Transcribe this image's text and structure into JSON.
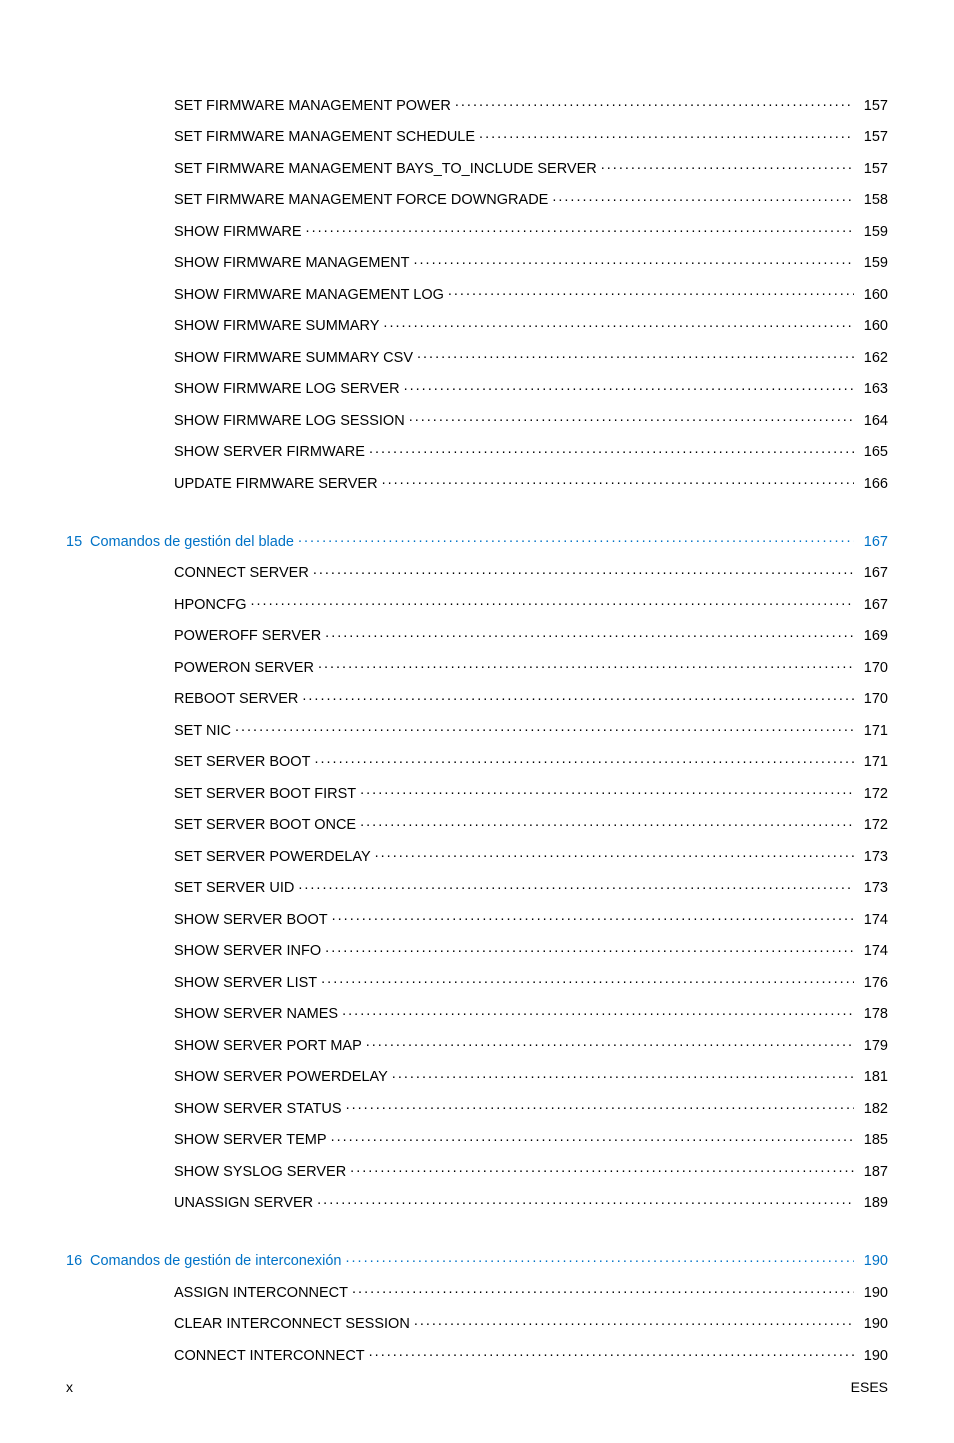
{
  "footer": {
    "left": "x",
    "right": "ESES"
  },
  "section0": {
    "items": [
      {
        "label": "SET FIRMWARE MANAGEMENT POWER",
        "page": "157"
      },
      {
        "label": "SET FIRMWARE MANAGEMENT SCHEDULE",
        "page": "157"
      },
      {
        "label": "SET FIRMWARE MANAGEMENT BAYS_TO_INCLUDE SERVER",
        "page": "157"
      },
      {
        "label": "SET FIRMWARE MANAGEMENT FORCE DOWNGRADE",
        "page": "158"
      },
      {
        "label": "SHOW FIRMWARE",
        "page": "159"
      },
      {
        "label": "SHOW FIRMWARE MANAGEMENT",
        "page": "159"
      },
      {
        "label": "SHOW FIRMWARE MANAGEMENT LOG",
        "page": "160"
      },
      {
        "label": "SHOW FIRMWARE SUMMARY",
        "page": "160"
      },
      {
        "label": "SHOW FIRMWARE SUMMARY CSV",
        "page": "162"
      },
      {
        "label": "SHOW FIRMWARE LOG SERVER",
        "page": "163"
      },
      {
        "label": "SHOW FIRMWARE LOG SESSION",
        "page": "164"
      },
      {
        "label": "SHOW SERVER FIRMWARE",
        "page": "165"
      },
      {
        "label": "UPDATE FIRMWARE SERVER",
        "page": "166"
      }
    ]
  },
  "section15": {
    "num": "15",
    "title": "Comandos de gestión del blade",
    "page": "167",
    "items": [
      {
        "label": "CONNECT SERVER",
        "page": "167"
      },
      {
        "label": "HPONCFG",
        "page": "167"
      },
      {
        "label": "POWEROFF SERVER",
        "page": "169"
      },
      {
        "label": "POWERON SERVER",
        "page": "170"
      },
      {
        "label": "REBOOT SERVER",
        "page": "170"
      },
      {
        "label": "SET NIC",
        "page": "171"
      },
      {
        "label": "SET SERVER BOOT",
        "page": "171"
      },
      {
        "label": "SET SERVER BOOT FIRST",
        "page": "172"
      },
      {
        "label": "SET SERVER BOOT ONCE",
        "page": "172"
      },
      {
        "label": "SET SERVER POWERDELAY",
        "page": "173"
      },
      {
        "label": "SET SERVER UID",
        "page": "173"
      },
      {
        "label": "SHOW SERVER BOOT",
        "page": "174"
      },
      {
        "label": "SHOW SERVER INFO",
        "page": "174"
      },
      {
        "label": "SHOW SERVER LIST",
        "page": "176"
      },
      {
        "label": "SHOW SERVER NAMES",
        "page": "178"
      },
      {
        "label": "SHOW SERVER PORT MAP",
        "page": "179"
      },
      {
        "label": "SHOW SERVER POWERDELAY",
        "page": "181"
      },
      {
        "label": "SHOW SERVER STATUS",
        "page": "182"
      },
      {
        "label": "SHOW SERVER TEMP",
        "page": "185"
      },
      {
        "label": "SHOW SYSLOG SERVER",
        "page": "187"
      },
      {
        "label": "UNASSIGN SERVER",
        "page": "189"
      }
    ]
  },
  "section16": {
    "num": "16",
    "title": "Comandos de gestión de interconexión",
    "page": "190",
    "items": [
      {
        "label": "ASSIGN INTERCONNECT",
        "page": "190"
      },
      {
        "label": "CLEAR INTERCONNECT SESSION",
        "page": "190"
      },
      {
        "label": "CONNECT INTERCONNECT",
        "page": "190"
      }
    ]
  }
}
